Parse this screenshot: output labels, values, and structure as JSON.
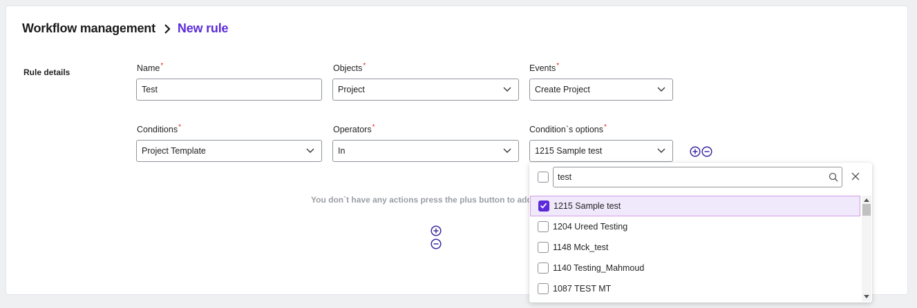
{
  "breadcrumb": {
    "parent": "Workflow management",
    "current": "New rule"
  },
  "section_label": "Rule details",
  "fields": {
    "name": {
      "label": "Name",
      "value": "Test"
    },
    "objects": {
      "label": "Objects",
      "value": "Project"
    },
    "events": {
      "label": "Events",
      "value": "Create Project"
    },
    "conditions": {
      "label": "Conditions",
      "value": "Project Template"
    },
    "operators": {
      "label": "Operators",
      "value": "In"
    },
    "condition_options": {
      "label": "Condition`s options",
      "value": "1215 Sample test"
    }
  },
  "required_marker": "*",
  "empty_actions_message": "You don`t have any actions press the plus button to add",
  "dropdown": {
    "search_value": "test",
    "items": [
      {
        "label": "1215 Sample test",
        "checked": true
      },
      {
        "label": "1204 Ureed Testing",
        "checked": false
      },
      {
        "label": "1148 Mck_test",
        "checked": false
      },
      {
        "label": "1140 Testing_Mahmoud",
        "checked": false
      },
      {
        "label": "1087 TEST MT",
        "checked": false
      }
    ]
  },
  "colors": {
    "accent": "#5b2bd9",
    "required": "#e0231c",
    "selected_bg": "#f0e8fb",
    "selected_border": "#d29be6"
  },
  "icons": [
    "chevron-right-icon",
    "chevron-down-icon",
    "plus-circle-icon",
    "minus-circle-icon",
    "search-icon",
    "close-icon",
    "check-icon"
  ]
}
